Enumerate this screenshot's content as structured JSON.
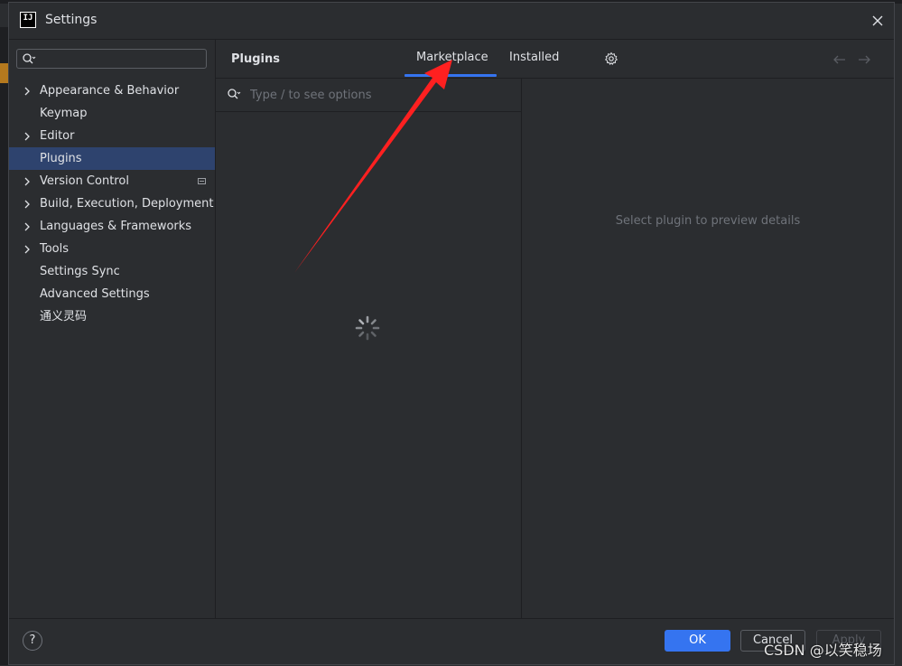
{
  "window": {
    "title": "Settings",
    "app_icon": "IJ"
  },
  "sidebar": {
    "search_value": "",
    "items": [
      {
        "label": "Appearance & Behavior",
        "expandable": true
      },
      {
        "label": "Keymap",
        "expandable": false
      },
      {
        "label": "Editor",
        "expandable": true
      },
      {
        "label": "Plugins",
        "expandable": false,
        "selected": true
      },
      {
        "label": "Version Control",
        "expandable": true
      },
      {
        "label": "Build, Execution, Deployment",
        "expandable": true
      },
      {
        "label": "Languages & Frameworks",
        "expandable": true
      },
      {
        "label": "Tools",
        "expandable": true
      },
      {
        "label": "Settings Sync",
        "expandable": false
      },
      {
        "label": "Advanced Settings",
        "expandable": false
      },
      {
        "label": "通义灵码",
        "expandable": false
      }
    ]
  },
  "plugins": {
    "title": "Plugins",
    "tabs": [
      {
        "label": "Marketplace",
        "active": true
      },
      {
        "label": "Installed",
        "active": false
      }
    ],
    "search_placeholder": "Type / to see options",
    "details_placeholder": "Select plugin to preview details"
  },
  "footer": {
    "help_label": "?",
    "ok_label": "OK",
    "cancel_label": "Cancel",
    "apply_label": "Apply"
  },
  "watermark": "CSDN @以笑稳场",
  "colors": {
    "background": "#2b2d30",
    "accent": "#3574f0",
    "selection": "#2e436e",
    "annotation": "#ff2020"
  }
}
